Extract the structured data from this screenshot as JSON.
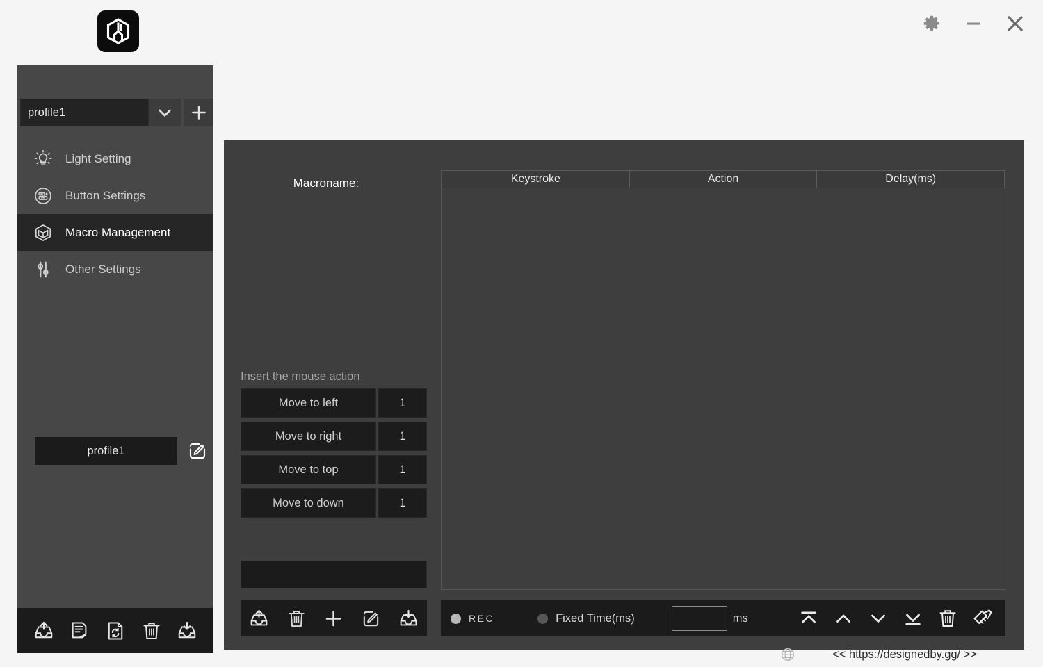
{
  "window": {
    "logo_icon": "hexagon-logo-icon",
    "controls": [
      {
        "name": "settings-button",
        "icon": "gear-icon"
      },
      {
        "name": "minimize-button",
        "icon": "minimize-icon"
      },
      {
        "name": "close-button",
        "icon": "close-icon"
      }
    ]
  },
  "sidebar": {
    "profile_selector": {
      "value": "profile1",
      "caret_icon": "chevron-down-icon",
      "add_icon": "plus-icon"
    },
    "items": [
      {
        "label": "Light Setting",
        "icon": "lightbulb-icon",
        "active": false
      },
      {
        "label": "Button Settings",
        "icon": "buttons-circle-icon",
        "active": false
      },
      {
        "label": "Macro Management",
        "icon": "cube-box-icon",
        "active": true
      },
      {
        "label": "Other Settings",
        "icon": "sliders-icon",
        "active": false
      }
    ],
    "profile_name": "profile1",
    "profile_edit_icon": "edit-pencil-icon",
    "toolbar": [
      {
        "name": "export-profile-button",
        "icon": "tray-up-icon"
      },
      {
        "name": "notes-profile-button",
        "icon": "document-lines-icon"
      },
      {
        "name": "reset-profile-button",
        "icon": "document-refresh-icon"
      },
      {
        "name": "delete-profile-button",
        "icon": "trash-icon"
      },
      {
        "name": "import-profile-button",
        "icon": "tray-down-icon"
      }
    ]
  },
  "main": {
    "macroname_label": "Macroname:",
    "insert_label": "Insert the mouse action",
    "mouse_actions": [
      {
        "label": "Move to left",
        "value": "1"
      },
      {
        "label": "Move to right",
        "value": "1"
      },
      {
        "label": "Move to top",
        "value": "1"
      },
      {
        "label": "Move to down",
        "value": "1"
      }
    ],
    "macro_input_value": "",
    "macro_input_placeholder": "",
    "left_toolbar": [
      {
        "name": "export-macro-button",
        "icon": "tray-up-icon"
      },
      {
        "name": "delete-macro-button",
        "icon": "trash-icon"
      },
      {
        "name": "add-macro-button",
        "icon": "plus-icon"
      },
      {
        "name": "edit-macro-button",
        "icon": "edit-pencil-icon"
      },
      {
        "name": "import-macro-button",
        "icon": "tray-down-icon"
      }
    ],
    "table": {
      "columns": [
        "Keystroke",
        "Action",
        "Delay(ms)"
      ],
      "rows": []
    },
    "rec_bar": {
      "rec_label": "REC",
      "rec_selected": true,
      "fixed_time_label": "Fixed Time(ms)",
      "fixed_time_selected": false,
      "fixed_time_value": "",
      "ms_unit": "ms",
      "actions": [
        {
          "name": "move-to-top-button",
          "icon": "chevron-bar-up-icon"
        },
        {
          "name": "move-up-button",
          "icon": "chevron-up-icon"
        },
        {
          "name": "move-down-button",
          "icon": "chevron-down-icon"
        },
        {
          "name": "move-to-bottom-button",
          "icon": "chevron-bar-down-icon"
        },
        {
          "name": "delete-row-button",
          "icon": "trash-icon"
        },
        {
          "name": "clear-all-button",
          "icon": "broom-icon"
        }
      ]
    }
  },
  "footer": {
    "globe_icon": "globe-icon",
    "link": "<< https://designedby.gg/ >>"
  }
}
